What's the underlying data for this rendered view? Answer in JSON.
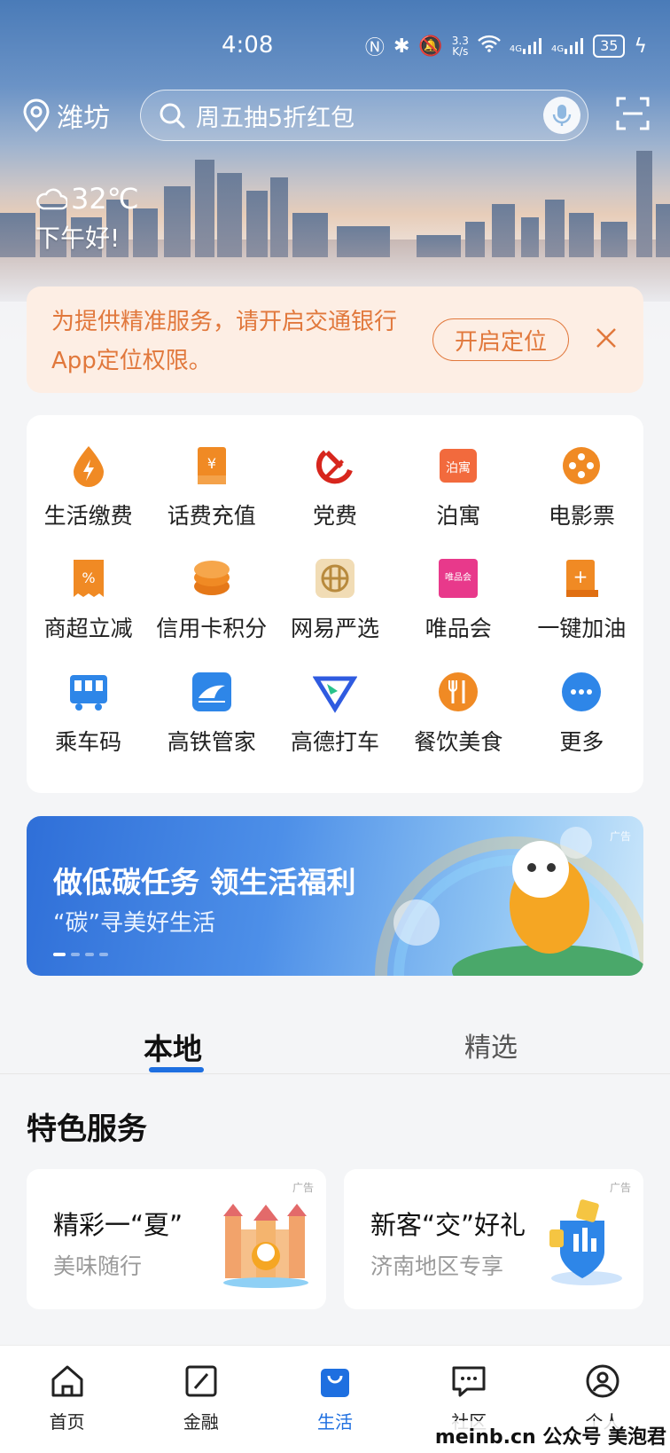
{
  "status_bar": {
    "time": "4:08",
    "speed": "3.3\nK/s",
    "battery": "35",
    "net1": "4G",
    "net2": "4G"
  },
  "header": {
    "location": "潍坊",
    "search_placeholder": "周五抽5折红包",
    "weather_temp": "32℃",
    "greeting": "下午好!"
  },
  "notice": {
    "text": "为提供精准服务，请开启交通银行App定位权限。",
    "button": "开启定位"
  },
  "services": [
    {
      "label": "生活缴费",
      "icon": "bolt-drop-icon",
      "color": "#f08a24"
    },
    {
      "label": "话费充值",
      "icon": "phone-bill-icon",
      "color": "#f08a24"
    },
    {
      "label": "党费",
      "icon": "party-emblem-icon",
      "color": "#d7261d"
    },
    {
      "label": "泊寓",
      "icon": "boyu-logo-icon",
      "color": "#f26a3d"
    },
    {
      "label": "电影票",
      "icon": "film-reel-icon",
      "color": "#f08a24"
    },
    {
      "label": "商超立减",
      "icon": "discount-receipt-icon",
      "color": "#f08a24"
    },
    {
      "label": "信用卡积分",
      "icon": "coin-stack-icon",
      "color": "#f08a24"
    },
    {
      "label": "网易严选",
      "icon": "netease-yanxuan-icon",
      "color": "#c9a15b"
    },
    {
      "label": "唯品会",
      "icon": "vip-logo-icon",
      "color": "#e8398b"
    },
    {
      "label": "一键加油",
      "icon": "fuel-icon",
      "color": "#f08a24"
    },
    {
      "label": "乘车码",
      "icon": "bus-qr-icon",
      "color": "#2e86e8"
    },
    {
      "label": "高铁管家",
      "icon": "train-icon",
      "color": "#2e86e8"
    },
    {
      "label": "高德打车",
      "icon": "amap-taxi-icon",
      "color": "#2f5be0"
    },
    {
      "label": "餐饮美食",
      "icon": "dining-icon",
      "color": "#f08a24"
    },
    {
      "label": "更多",
      "icon": "more-icon",
      "color": "#2e86e8"
    }
  ],
  "banner": {
    "title": "做低碳任务 领生活福利",
    "subtitle": "“碳”寻美好生活",
    "ad_label": "广告"
  },
  "tabs": {
    "local": "本地",
    "featured": "精选"
  },
  "section": {
    "title": "特色服务"
  },
  "cards": [
    {
      "title": "精彩一“夏”",
      "subtitle": "美味随行",
      "ad_label": "广告"
    },
    {
      "title": "新客“交”好礼",
      "subtitle": "济南地区专享",
      "ad_label": "广告"
    }
  ],
  "bottom_nav": [
    {
      "label": "首页",
      "icon": "home-icon"
    },
    {
      "label": "金融",
      "icon": "finance-icon"
    },
    {
      "label": "生活",
      "icon": "shopping-bag-icon",
      "active": true
    },
    {
      "label": "社区",
      "icon": "chat-icon"
    },
    {
      "label": "个人",
      "icon": "person-icon"
    }
  ],
  "watermark": "meinb.cn 公众号 美泡君"
}
